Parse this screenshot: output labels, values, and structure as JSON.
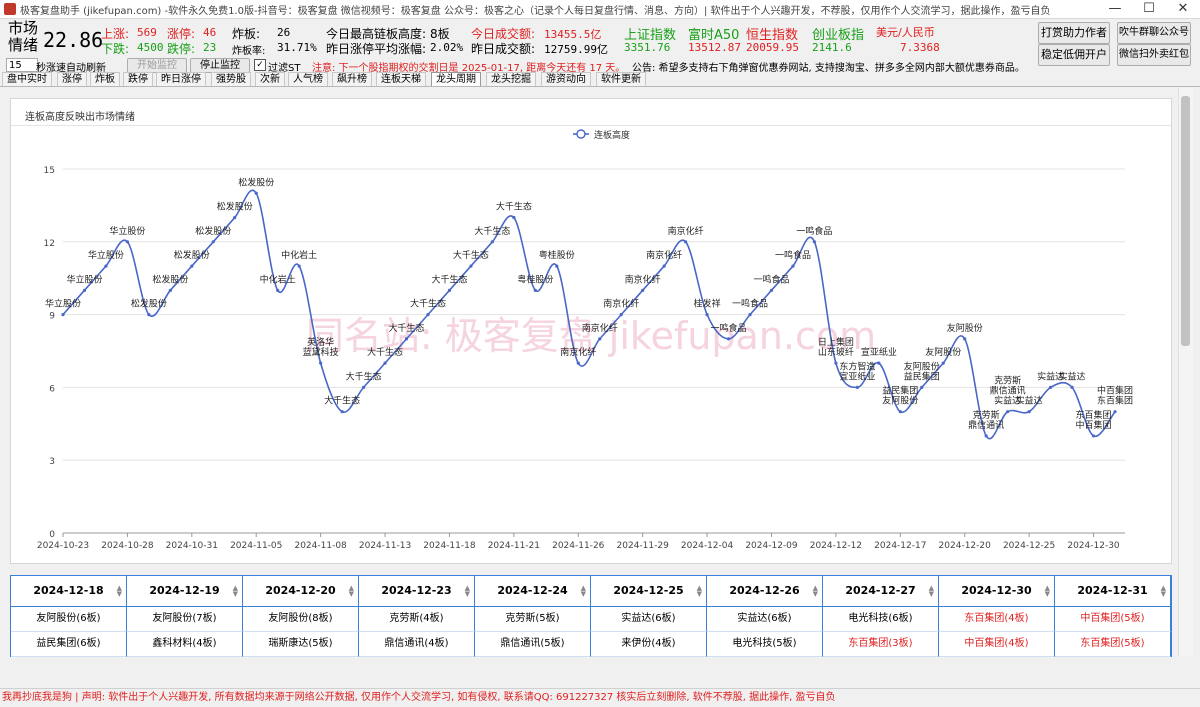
{
  "window": {
    "title": "极客复盘助手 (jikefupan.com) -软件永久免费1.0版-抖音号：极客复盘 微信视频号：极客复盘 公众号：极客之心（记录个人每日复盘行情、消息、方向）| 软件出于个人兴趣开发，不荐股，仅用作个人交流学习，据此操作，盈亏自负",
    "minimize": "—",
    "maximize": "☐",
    "close": "✕"
  },
  "header": {
    "market_label_1": "市场",
    "market_label_2": "情绪",
    "market_value": "22.86",
    "up_label": "上涨:",
    "up_value": "569",
    "limit_up_label": "涨停:",
    "limit_up_value": "46",
    "down_label": "下跌:",
    "down_value": "4500",
    "limit_down_label": "跌停:",
    "limit_down_value": "23",
    "broken_label": "炸板:",
    "broken_value": "26",
    "broken_rate_label": "炸板率:",
    "broken_rate_value": "31.71%",
    "max_chain_label": "今日最高链板高度:",
    "max_chain_value": "8板",
    "avg_gain_label": "昨日涨停平均涨幅:",
    "avg_gain_value": "2.02%",
    "turnover_today_label": "今日成交额:",
    "turnover_today_value": "13455.5亿",
    "turnover_yest_label": "昨日成交额:",
    "turnover_yest_value": "12759.99亿",
    "indices": [
      {
        "name": "上证指数",
        "value": "3351.76",
        "name_color": "#18a018",
        "value_color": "#18a018"
      },
      {
        "name": "富时A50",
        "value": "13512.87",
        "name_color": "#18a018",
        "value_color": "#e02020"
      },
      {
        "name": "恒生指数",
        "value": "20059.95",
        "name_color": "#e02020",
        "value_color": "#e02020"
      },
      {
        "name": "创业板指",
        "value": "2141.6",
        "name_color": "#18a018",
        "value_color": "#18a018"
      },
      {
        "name": "美元/人民币",
        "value": "7.3368",
        "name_color": "#e02020",
        "value_color": "#e02020"
      }
    ],
    "buttons": {
      "tip_author": "打赏助力作者",
      "hire_dev": "稳定低佣开户",
      "blow_cow": "吹牛群聊公众号",
      "wechat_scan": "微信扫外卖红包"
    }
  },
  "controls": {
    "refresh_seconds": "15",
    "refresh_label": "秒涨速自动刷新",
    "start_monitor": "开始监控",
    "stop_monitor": "停止监控",
    "filter_st": "过滤ST",
    "notice": "注意: 下一个股指期权的交割日是 2025-01-17, 距离今天还有 17 天。",
    "announcement": "公告: 希望多支持右下角弹窗优惠券网站, 支持搜淘宝、拼多多全网内部大额优惠券商品。"
  },
  "tabs": [
    "盘中实时",
    "涨停",
    "炸板",
    "跌停",
    "昨日涨停",
    "强势股",
    "次新",
    "人气榜",
    "飙升榜",
    "连板天梯",
    "龙头周期",
    "龙头挖掘",
    "游资动向",
    "软件更新"
  ],
  "active_tab": 10,
  "panel": {
    "title": "连板高度反映出市场情绪"
  },
  "chart_data": {
    "type": "line",
    "title": "",
    "legend": [
      "连板高度"
    ],
    "legend_placement": "top-center",
    "ylim": [
      0,
      15
    ],
    "yticks": [
      0,
      3,
      6,
      9,
      12,
      15
    ],
    "grid": true,
    "line_color": "#4a67c7",
    "x_tick_labels": [
      "2024-10-23",
      "2024-10-28",
      "2024-10-31",
      "2024-11-05",
      "2024-11-08",
      "2024-11-13",
      "2024-11-18",
      "2024-11-21",
      "2024-11-26",
      "2024-11-29",
      "2024-12-04",
      "2024-12-09",
      "2024-12-12",
      "2024-12-17",
      "2024-12-20",
      "2024-12-25",
      "2024-12-30"
    ],
    "x_tick_at": [
      0,
      3,
      6,
      9,
      12,
      15,
      18,
      21,
      24,
      27,
      30,
      33,
      36,
      39,
      42,
      45,
      48
    ],
    "series": [
      {
        "name": "连板高度",
        "values": [
          9,
          10,
          11,
          12,
          9,
          10,
          11,
          12,
          13,
          14,
          10,
          11,
          7,
          5,
          6,
          7,
          8,
          9,
          10,
          11,
          12,
          13,
          10,
          11,
          7,
          8,
          9,
          10,
          11,
          12,
          9,
          8,
          9,
          10,
          11,
          12,
          7,
          6,
          7,
          5,
          6,
          7,
          8,
          4,
          5,
          5,
          6,
          6,
          4,
          5
        ],
        "labels": [
          "华立股份",
          "华立股份",
          "华立股份",
          "华立股份",
          "松发股份",
          "松发股份",
          "松发股份",
          "松发股份",
          "松发股份",
          "松发股份",
          "中化岩土",
          "中化岩土",
          "英洛华|蓝黛科技",
          "大千生态",
          "大千生态",
          "大千生态",
          "大千生态",
          "大千生态",
          "大千生态",
          "大千生态",
          "大千生态",
          "大千生态",
          "粤桂股份",
          "粤桂股份",
          "南京化纤",
          "南京化纤",
          "南京化纤",
          "南京化纤",
          "南京化纤",
          "南京化纤",
          "桂发祥",
          "一鸣食品",
          "一鸣食品",
          "一鸣食品",
          "一鸣食品",
          "一鸣食品",
          "日上集团|山东玻纤",
          "东方智造|宣亚纸业",
          "宣亚纸业",
          "益民集团|友阿股份",
          "友阿股份|益民集团",
          "友阿股份",
          "友阿股份",
          "克劳斯|鼎信通讯",
          "克劳斯|鼎信通讯|实益达",
          "实益达",
          "实益达",
          "实益达",
          "东百集团|中百集团",
          "中百集团|东百集团"
        ]
      }
    ]
  },
  "watermark": "同名站: 极客复盘 jikefupan.com",
  "table": {
    "columns": [
      "2024-12-18",
      "2024-12-19",
      "2024-12-20",
      "2024-12-23",
      "2024-12-24",
      "2024-12-25",
      "2024-12-26",
      "2024-12-27",
      "2024-12-30",
      "2024-12-31"
    ],
    "header_colors": [
      "#000",
      "#000",
      "#000",
      "#000",
      "#000",
      "#000",
      "#000",
      "#000",
      "#000",
      "#000"
    ],
    "rows": [
      {
        "cells": [
          "友阿股份(6板)",
          "友阿股份(7板)",
          "友阿股份(8板)",
          "克劳斯(4板)",
          "克劳斯(5板)",
          "实益达(6板)",
          "实益达(6板)",
          "电光科技(6板)",
          "东百集团(4板)",
          "中百集团(5板)"
        ],
        "colors": [
          "#000",
          "#000",
          "#000",
          "#000",
          "#000",
          "#000",
          "#000",
          "#000",
          "#e02020",
          "#e02020"
        ]
      },
      {
        "cells": [
          "益民集团(6板)",
          "鑫科材料(4板)",
          "瑞斯康达(5板)",
          "鼎信通讯(4板)",
          "鼎信通讯(5板)",
          "来伊份(4板)",
          "电光科技(5板)",
          "东百集团(3板)",
          "中百集团(4板)",
          "东百集团(5板)"
        ],
        "colors": [
          "#000",
          "#000",
          "#000",
          "#000",
          "#000",
          "#000",
          "#000",
          "#e02020",
          "#e02020",
          "#e02020"
        ]
      }
    ]
  },
  "status_bar": "我再抄底我是狗 | 声明: 软件出于个人兴趣开发, 所有数据均来源于网络公开数据, 仅用作个人交流学习, 如有侵权, 联系请QQ: 691227327 核实后立刻删除, 软件不荐股, 据此操作, 盈亏自负"
}
